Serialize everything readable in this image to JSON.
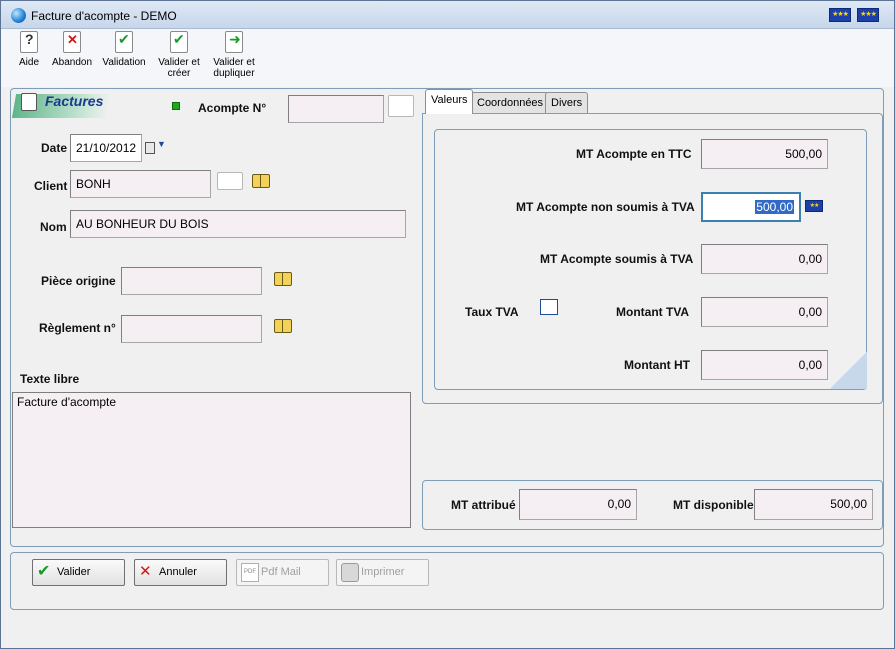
{
  "window": {
    "title": "Facture d'acompte - DEMO"
  },
  "toolbar": {
    "help": "Aide",
    "abort": "Abandon",
    "validate": "Validation",
    "validate_create_1": "Valider et",
    "validate_create_2": "créer",
    "validate_dup_1": "Valider et",
    "validate_dup_2": "dupliquer"
  },
  "header": {
    "section_title": "Factures",
    "acompte_label": "Acompte N°",
    "acompte_value": ""
  },
  "form": {
    "date_label": "Date",
    "date_value": "21/10/2012",
    "client_label": "Client",
    "client_value": "BONH",
    "nom_label": "Nom",
    "nom_value": "AU BONHEUR DU BOIS",
    "piece_label": "Pièce origine",
    "piece_value": "",
    "reglement_label": "Règlement n°",
    "reglement_value": "",
    "texte_label": "Texte libre",
    "texte_value": "Facture d'acompte"
  },
  "tabs": [
    {
      "label": "Valeurs",
      "active": true
    },
    {
      "label": "Coordonnées",
      "active": false
    },
    {
      "label": "Divers",
      "active": false
    }
  ],
  "valeurs": {
    "ttc_label": "MT Acompte en TTC",
    "ttc_value": "500,00",
    "non_soumis_label": "MT Acompte non soumis à TVA",
    "non_soumis_value": "500,00",
    "soumis_label": "MT Acompte soumis à TVA",
    "soumis_value": "0,00",
    "taux_label": "Taux TVA",
    "montant_tva_label": "Montant TVA",
    "montant_tva_value": "0,00",
    "montant_ht_label": "Montant HT",
    "montant_ht_value": "0,00"
  },
  "totals": {
    "attribue_label": "MT attribué",
    "attribue_value": "0,00",
    "disponible_label": "MT disponible",
    "disponible_value": "500,00"
  },
  "buttons": {
    "valider": "Valider",
    "annuler": "Annuler",
    "pdf_mail": "Pdf Mail",
    "imprimer": "Imprimer"
  }
}
